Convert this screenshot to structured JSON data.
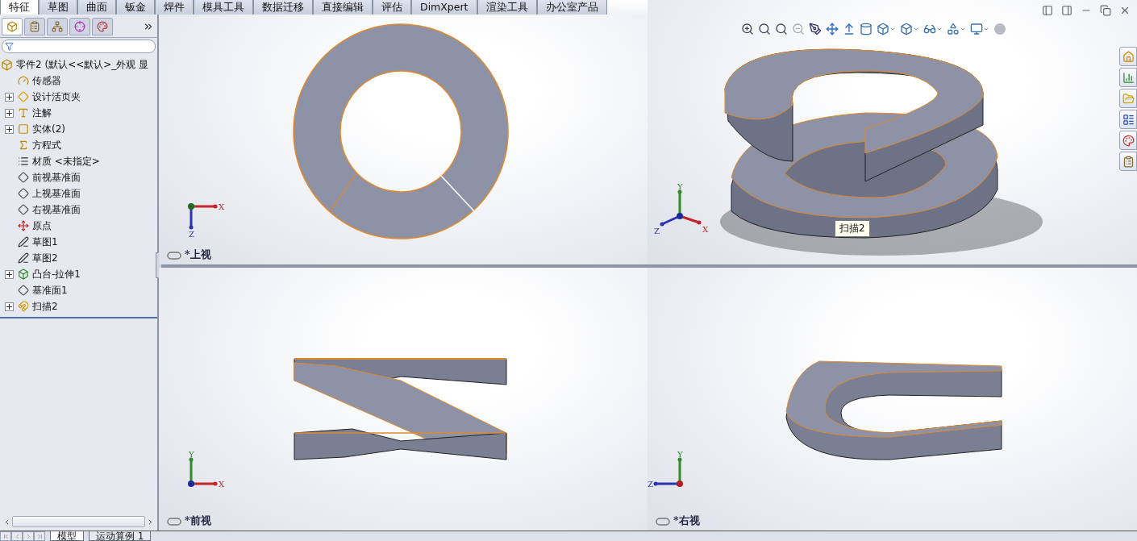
{
  "command_tabs": [
    {
      "label": "特征",
      "selected": true
    },
    {
      "label": "草图",
      "selected": false
    },
    {
      "label": "曲面",
      "selected": false
    },
    {
      "label": "钣金",
      "selected": false
    },
    {
      "label": "焊件",
      "selected": false
    },
    {
      "label": "模具工具",
      "selected": false
    },
    {
      "label": "数据迁移",
      "selected": false
    },
    {
      "label": "直接编辑",
      "selected": false
    },
    {
      "label": "评估",
      "selected": false
    },
    {
      "label": "DimXpert",
      "selected": false
    },
    {
      "label": "渲染工具",
      "selected": false
    },
    {
      "label": "办公室产品",
      "selected": false
    }
  ],
  "panel_tabs": [
    {
      "kind": "part",
      "selected": true
    },
    {
      "kind": "properties",
      "selected": false
    },
    {
      "kind": "config",
      "selected": false
    },
    {
      "kind": "target",
      "selected": false
    },
    {
      "kind": "appearance",
      "selected": false
    }
  ],
  "tree": {
    "label": "零件2  (默认<<默认>_外观 显",
    "kind": "part",
    "children": [
      {
        "label": "传感器",
        "kind": "sensor",
        "expandable": false
      },
      {
        "label": "设计活页夹",
        "kind": "binder",
        "expandable": true
      },
      {
        "label": "注解",
        "kind": "annotation",
        "expandable": true
      },
      {
        "label": "实体(2)",
        "kind": "bodies",
        "expandable": true
      },
      {
        "label": "方程式",
        "kind": "equation",
        "expandable": false
      },
      {
        "label": "材质 <未指定>",
        "kind": "material",
        "expandable": false
      },
      {
        "label": "前视基准面",
        "kind": "plane",
        "expandable": false
      },
      {
        "label": "上视基准面",
        "kind": "plane",
        "expandable": false
      },
      {
        "label": "右视基准面",
        "kind": "plane",
        "expandable": false
      },
      {
        "label": "原点",
        "kind": "origin",
        "expandable": false
      },
      {
        "label": "草图1",
        "kind": "sketch",
        "expandable": false
      },
      {
        "label": "草图2",
        "kind": "sketch",
        "expandable": false
      },
      {
        "label": "凸台-拉伸1",
        "kind": "extrude",
        "expandable": true
      },
      {
        "label": "基准面1",
        "kind": "plane",
        "expandable": false
      },
      {
        "label": "扫描2",
        "kind": "sweep",
        "expandable": true
      }
    ]
  },
  "viewports": [
    {
      "kind": "top",
      "label": "*上视",
      "axes": [
        {
          "kind": "x",
          "label": "X"
        },
        {
          "kind": "z",
          "label": "Z"
        }
      ]
    },
    {
      "kind": "iso",
      "tooltip": "扫描2",
      "axes": [
        {
          "kind": "y",
          "label": "Y"
        },
        {
          "kind": "z",
          "label": "Z"
        },
        {
          "kind": "x",
          "label": "X"
        }
      ]
    },
    {
      "kind": "front",
      "label": "*前视",
      "axes": [
        {
          "kind": "y",
          "label": "Y"
        },
        {
          "kind": "x",
          "label": "X"
        }
      ]
    },
    {
      "kind": "right",
      "label": "*右视",
      "axes": [
        {
          "kind": "y",
          "label": "Y"
        },
        {
          "kind": "z",
          "label": "Z"
        }
      ]
    }
  ],
  "bottom_tabs": [
    {
      "label": "模型",
      "selected": true
    },
    {
      "label": "运动算例 1",
      "selected": false
    }
  ]
}
